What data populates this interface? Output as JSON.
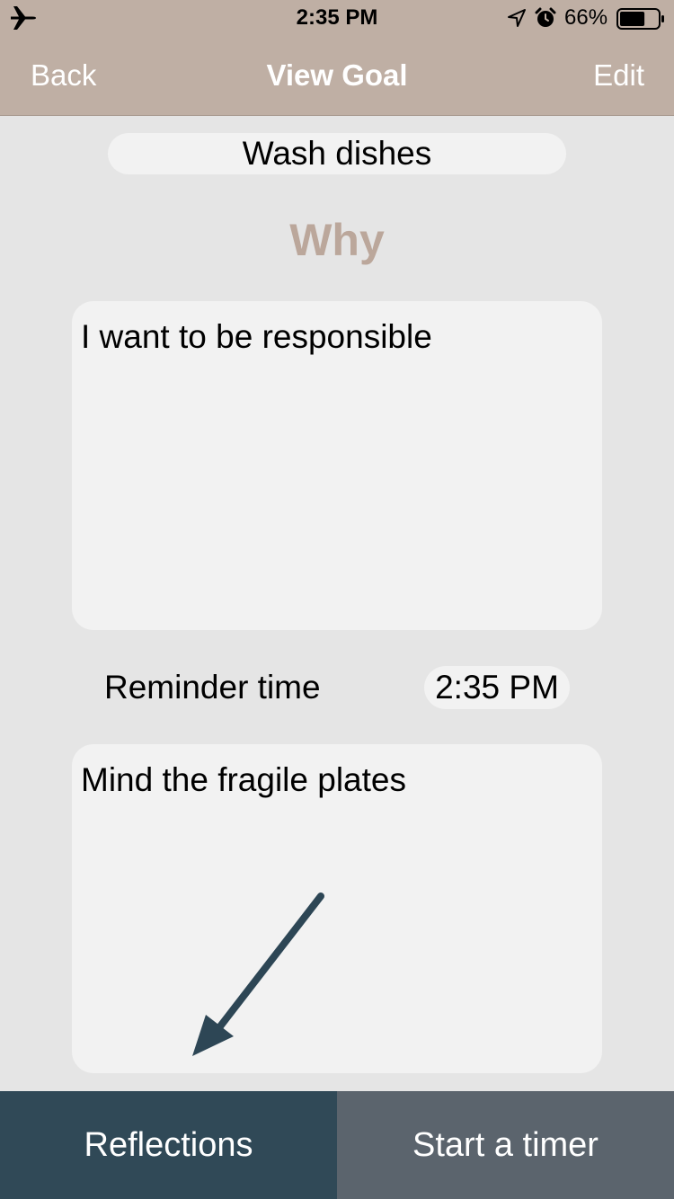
{
  "status_bar": {
    "time": "2:35 PM",
    "battery_percent": "66%",
    "battery_level": 0.66,
    "icons": [
      "airplane-icon",
      "location-arrow-icon",
      "alarm-clock-icon",
      "battery-icon"
    ]
  },
  "nav": {
    "back_label": "Back",
    "title": "View Goal",
    "edit_label": "Edit"
  },
  "goal": {
    "name": "Wash dishes",
    "why_heading": "Why",
    "why_text": "I want to be responsible",
    "reminder_label": "Reminder time",
    "reminder_time": "2:35 PM",
    "notes_text": "Mind the fragile plates"
  },
  "bottom_bar": {
    "reflections_label": "Reflections",
    "timer_label": "Start a timer"
  },
  "colors": {
    "nav_background": "#bfafa4",
    "page_background": "#e5e5e5",
    "field_background": "#f2f2f2",
    "why_heading": "#bba79b",
    "reflections_button": "#304957",
    "timer_button": "#5b646d",
    "arrow": "#2d4655"
  }
}
